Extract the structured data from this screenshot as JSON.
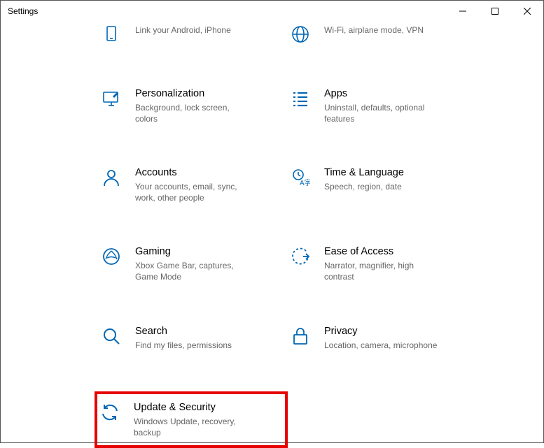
{
  "window": {
    "title": "Settings"
  },
  "items": {
    "phone": {
      "label": "",
      "desc": "Link your Android, iPhone"
    },
    "network": {
      "label": "",
      "desc": "Wi-Fi, airplane mode, VPN"
    },
    "personalization": {
      "label": "Personalization",
      "desc": "Background, lock screen, colors"
    },
    "apps": {
      "label": "Apps",
      "desc": "Uninstall, defaults, optional features"
    },
    "accounts": {
      "label": "Accounts",
      "desc": "Your accounts, email, sync, work, other people"
    },
    "time": {
      "label": "Time & Language",
      "desc": "Speech, region, date"
    },
    "gaming": {
      "label": "Gaming",
      "desc": "Xbox Game Bar, captures, Game Mode"
    },
    "ease": {
      "label": "Ease of Access",
      "desc": "Narrator, magnifier, high contrast"
    },
    "search": {
      "label": "Search",
      "desc": "Find my files, permissions"
    },
    "privacy": {
      "label": "Privacy",
      "desc": "Location, camera, microphone"
    },
    "update": {
      "label": "Update & Security",
      "desc": "Windows Update, recovery, backup"
    }
  }
}
